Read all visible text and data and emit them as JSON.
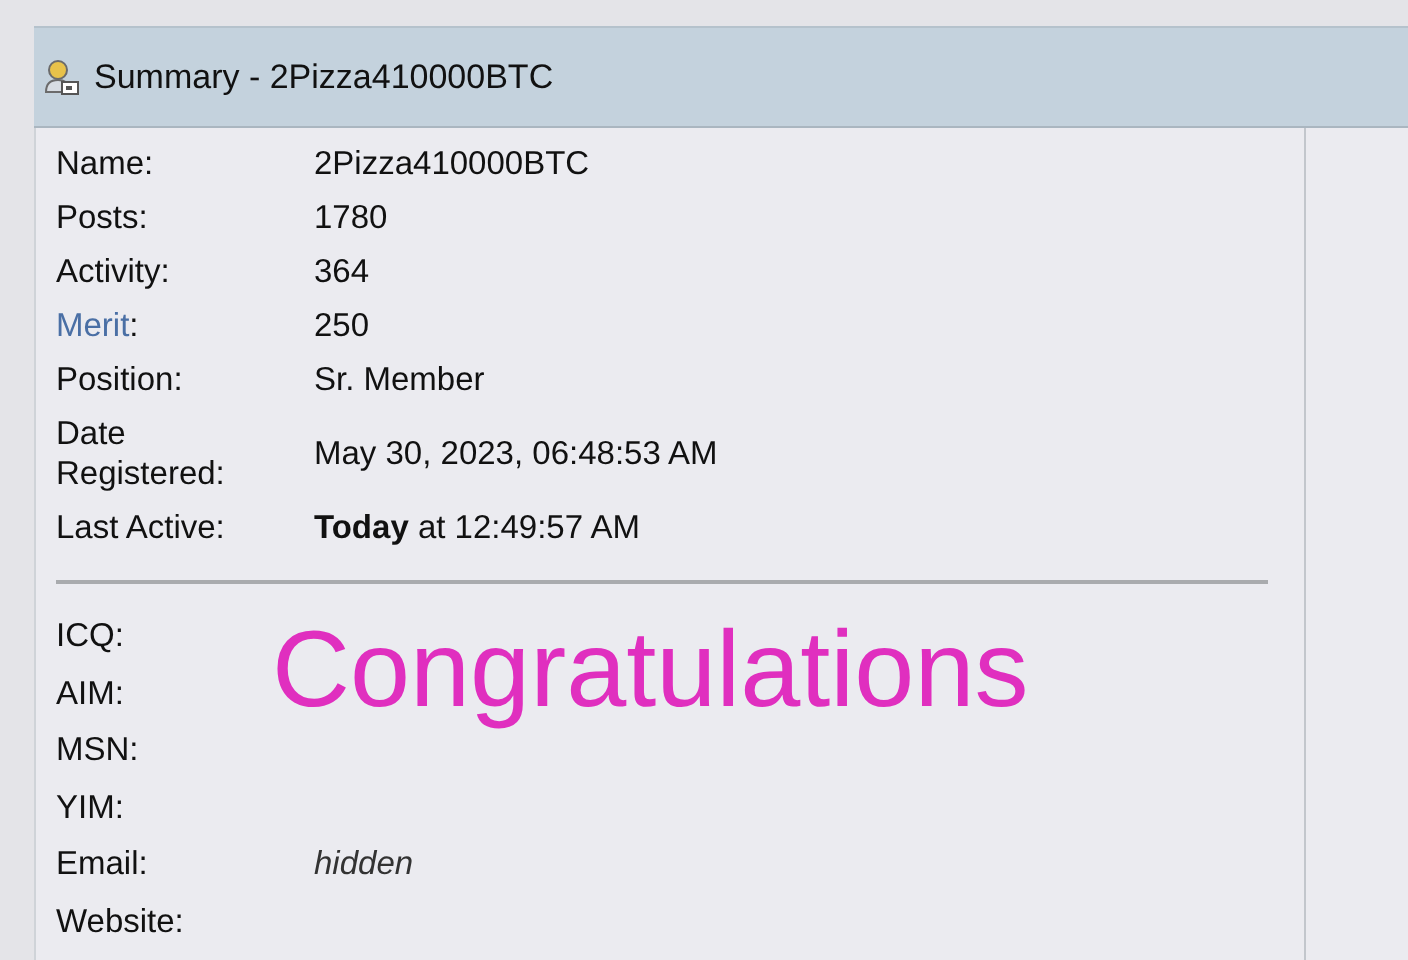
{
  "header": {
    "title": "Summary - 2Pizza410000BTC"
  },
  "details": [
    {
      "label": "Name:",
      "value": "2Pizza410000BTC",
      "link": false
    },
    {
      "label": "Posts:",
      "value": "1780",
      "link": false
    },
    {
      "label": "Activity:",
      "value": "364",
      "link": false
    },
    {
      "label": "Merit",
      "suffix": ":",
      "value": "250",
      "link": true
    },
    {
      "label": "Position:",
      "value": "Sr. Member",
      "link": false
    },
    {
      "label": "Date Registered:",
      "value": "May 30, 2023, 06:48:53 AM",
      "link": false
    },
    {
      "label": "Last Active:",
      "value": "**Today** at 12:49:57 AM",
      "link": false
    }
  ],
  "contacts": [
    {
      "label": "ICQ:"
    },
    {
      "label": "AIM:"
    },
    {
      "label": "MSN:"
    },
    {
      "label": "YIM:"
    },
    {
      "label": "Email:",
      "value": "hidden"
    },
    {
      "label": "Website:"
    }
  ],
  "overlay": {
    "text": "Congratulations"
  }
}
